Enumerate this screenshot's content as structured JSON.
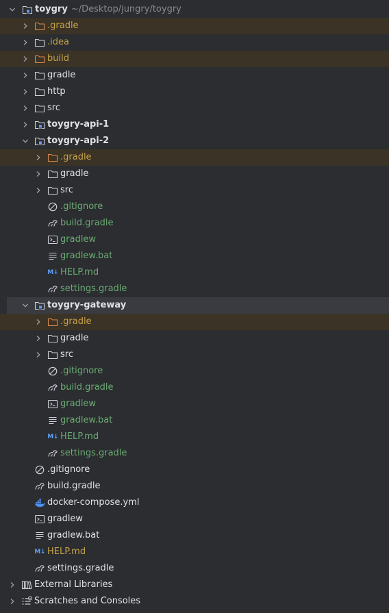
{
  "project": {
    "name": "toygry",
    "path": "~/Desktop/jungry/toygry"
  },
  "root_children": [
    {
      "label": ".gradle"
    },
    {
      "label": ".idea"
    },
    {
      "label": "build"
    },
    {
      "label": "gradle"
    },
    {
      "label": "http"
    },
    {
      "label": "src"
    },
    {
      "label": "toygry-api-1"
    },
    {
      "label": "toygry-api-2"
    }
  ],
  "api2": [
    {
      "label": ".gradle"
    },
    {
      "label": "gradle"
    },
    {
      "label": "src"
    },
    {
      "label": ".gitignore"
    },
    {
      "label": "build.gradle"
    },
    {
      "label": "gradlew"
    },
    {
      "label": "gradlew.bat"
    },
    {
      "label": "HELP.md"
    },
    {
      "label": "settings.gradle"
    }
  ],
  "gateway_label": "toygry-gateway",
  "gateway": [
    {
      "label": ".gradle"
    },
    {
      "label": "gradle"
    },
    {
      "label": "src"
    },
    {
      "label": ".gitignore"
    },
    {
      "label": "build.gradle"
    },
    {
      "label": "gradlew"
    },
    {
      "label": "gradlew.bat"
    },
    {
      "label": "HELP.md"
    },
    {
      "label": "settings.gradle"
    }
  ],
  "root_files": [
    {
      "label": ".gitignore"
    },
    {
      "label": "build.gradle"
    },
    {
      "label": "docker-compose.yml"
    },
    {
      "label": "gradlew"
    },
    {
      "label": "gradlew.bat"
    },
    {
      "label": "HELP.md"
    },
    {
      "label": "settings.gradle"
    }
  ],
  "extra": [
    {
      "label": "External Libraries"
    },
    {
      "label": "Scratches and Consoles"
    }
  ],
  "md_badge": "M↓",
  "colors": {
    "background": "#2b2d30",
    "excluded_row": "#3b3326",
    "selected_row": "#393b40",
    "text": "#dfe1e5",
    "excluded_text": "#c7a248",
    "vcs_new_text": "#6aab73",
    "path_text": "#868a91",
    "module_icon": "#5e9ff6"
  },
  "icons": {
    "expanded": "chevron-down-icon",
    "collapsed": "chevron-right-icon",
    "folder": "folder-icon",
    "module": "module-folder-icon",
    "ignore": "gitignore-icon",
    "gradle": "gradle-icon",
    "shell": "terminal-script-icon",
    "text": "text-file-icon",
    "markdown": "markdown-icon",
    "docker": "docker-icon",
    "library": "library-icon",
    "scratch": "scratches-icon"
  }
}
